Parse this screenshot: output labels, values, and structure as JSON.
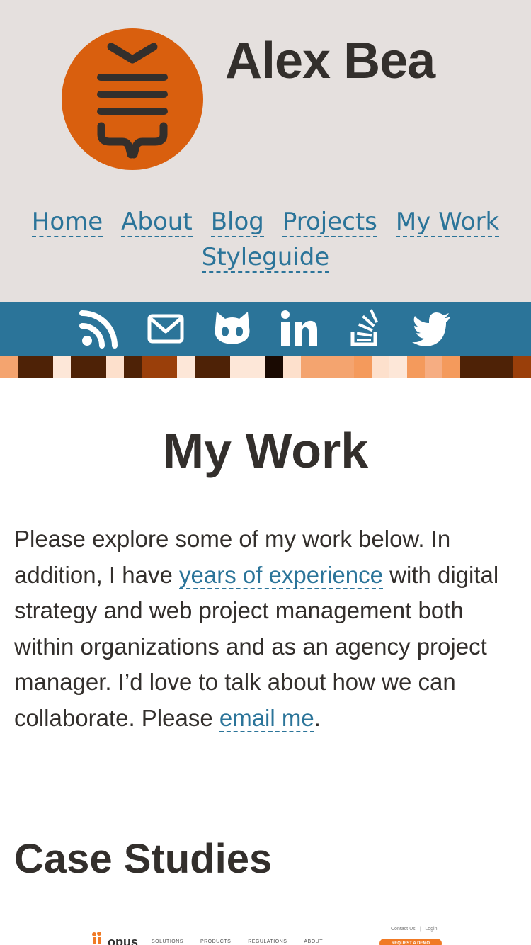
{
  "site": {
    "title": "Alex Bea",
    "logo_icon": "sitemap-logo-icon",
    "accent_color": "#d95f0e",
    "header_bg": "#e5e0de",
    "link_color": "#2b7499"
  },
  "nav": {
    "items": [
      "Home",
      "About",
      "Blog",
      "Projects",
      "My Work",
      "Styleguide"
    ]
  },
  "social": {
    "icons": [
      "rss-icon",
      "email-icon",
      "github-icon",
      "linkedin-icon",
      "stackoverflow-icon",
      "twitter-icon"
    ],
    "bar_color": "#2b7499"
  },
  "page": {
    "title": "My Work",
    "intro_before_link": "Please explore some of my work below. In addition, I have ",
    "intro_link_experience": "years of experience",
    "intro_after_link": " with digital strategy and web project management both within organizations and as an agency project manager. I’d love to talk about how we can collaborate. Please ",
    "intro_link_email": "email me",
    "intro_end": ".",
    "section_title": "Case Studies"
  },
  "preview": {
    "brand": "opus",
    "nav_items": [
      "SOLUTIONS",
      "PRODUCTS",
      "REGULATIONS",
      "ABOUT"
    ],
    "top_links": [
      "Contact Us",
      "Login"
    ],
    "button": "REQUEST A DEMO"
  }
}
